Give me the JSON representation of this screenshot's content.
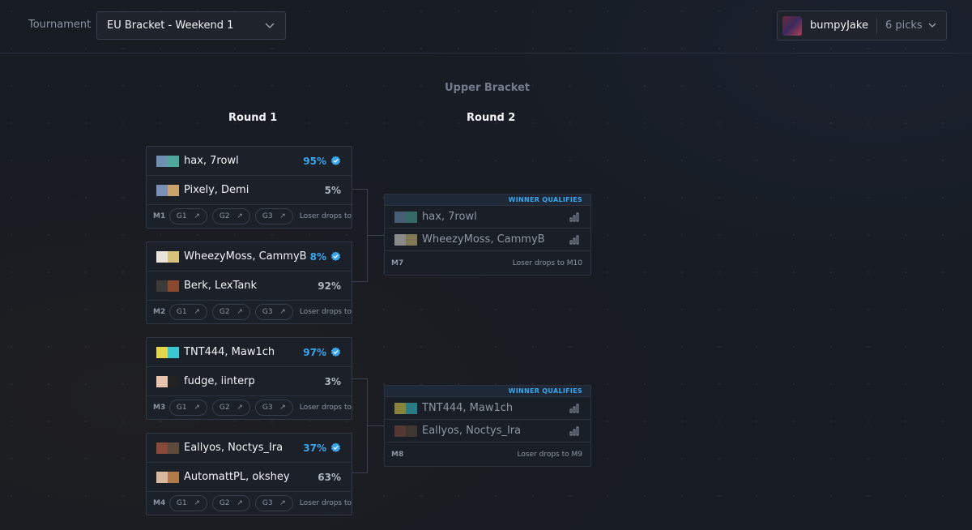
{
  "header": {
    "tournament_label": "Tournament",
    "tournament_value": "EU Bracket - Weekend 1",
    "username": "bumpyJake",
    "picks": "6 picks"
  },
  "bracket_title": "Upper Bracket",
  "rounds": [
    "Round 1",
    "Round 2"
  ],
  "colors": {
    "accent": "#3aa6ee",
    "background": "#171b22"
  },
  "round1": [
    {
      "id": "M1",
      "teams": [
        {
          "name": "hax, 7rowl",
          "pct": "95%",
          "picked": true
        },
        {
          "name": "Pixely, Demi",
          "pct": "5%",
          "picked": false
        }
      ],
      "games": [
        "G1",
        "G2",
        "G3"
      ],
      "drop_text": "Loser drops to"
    },
    {
      "id": "M2",
      "teams": [
        {
          "name": "WheezyMoss, CammyB",
          "pct": "8%",
          "picked": true
        },
        {
          "name": "Berk, LexTank",
          "pct": "92%",
          "picked": false
        }
      ],
      "games": [
        "G1",
        "G2",
        "G3"
      ],
      "drop_text": "Loser drops to"
    },
    {
      "id": "M3",
      "teams": [
        {
          "name": "TNT444, Maw1ch",
          "pct": "97%",
          "picked": true
        },
        {
          "name": "fudge, iinterp",
          "pct": "3%",
          "picked": false
        }
      ],
      "games": [
        "G1",
        "G2",
        "G3"
      ],
      "drop_text": "Loser drops to"
    },
    {
      "id": "M4",
      "teams": [
        {
          "name": "Eallyos, Noctys_Ira",
          "pct": "37%",
          "picked": true
        },
        {
          "name": "AutomattPL, okshey",
          "pct": "63%",
          "picked": false
        }
      ],
      "games": [
        "G1",
        "G2",
        "G3"
      ],
      "drop_text": "Loser drops to"
    }
  ],
  "round2": [
    {
      "id": "M7",
      "banner": "WINNER QUALIFIES",
      "teams": [
        "hax, 7rowl",
        "WheezyMoss, CammyB"
      ],
      "drop_text": "Loser drops to M10"
    },
    {
      "id": "M8",
      "banner": "WINNER QUALIFIES",
      "teams": [
        "TNT444, Maw1ch",
        "Eallyos, Noctys_Ira"
      ],
      "drop_text": "Loser drops to M9"
    }
  ]
}
